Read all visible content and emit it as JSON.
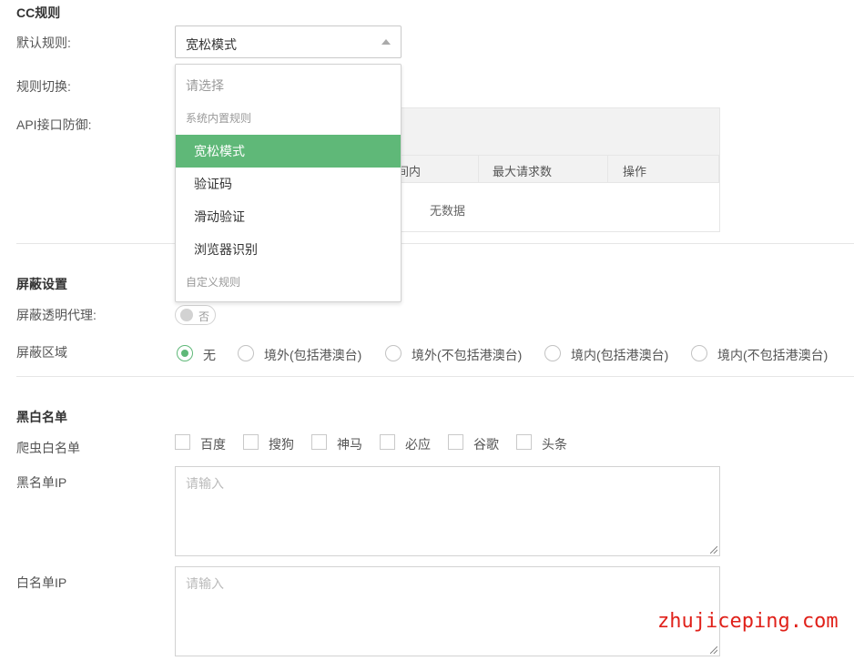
{
  "cc": {
    "section_title": "CC规则",
    "default_rule_label": "默认规则:",
    "default_rule_value": "宽松模式",
    "switch_label": "规则切换:",
    "api_label": "API接口防御:",
    "dropdown": {
      "placeholder": "请选择",
      "group_system": "系统内置规则",
      "options": [
        "宽松模式",
        "验证码",
        "滑动验证",
        "浏览器识别"
      ],
      "selected": "宽松模式",
      "group_custom": "自定义规则"
    },
    "table": {
      "col_partial": "间内",
      "col_max": "最大请求数",
      "col_action": "操作",
      "empty": "无数据"
    }
  },
  "shield": {
    "section_title": "屏蔽设置",
    "proxy_label": "屏蔽透明代理:",
    "proxy_toggle_text": "否",
    "region_label": "屏蔽区域",
    "region_options": [
      "无",
      "境外(包括港澳台)",
      "境外(不包括港澳台)",
      "境内(包括港澳台)",
      "境内(不包括港澳台)"
    ],
    "region_selected": "无"
  },
  "lists": {
    "section_title": "黑白名单",
    "crawler_label": "爬虫白名单",
    "crawlers": [
      "百度",
      "搜狗",
      "神马",
      "必应",
      "谷歌",
      "头条"
    ],
    "blacklist_label": "黑名单IP",
    "blacklist_placeholder": "请输入",
    "whitelist_label": "白名单IP",
    "whitelist_placeholder": "请输入"
  },
  "watermark": "zhujiceping.com",
  "colors": {
    "accent": "#5fb878",
    "watermark": "#e0211a"
  }
}
